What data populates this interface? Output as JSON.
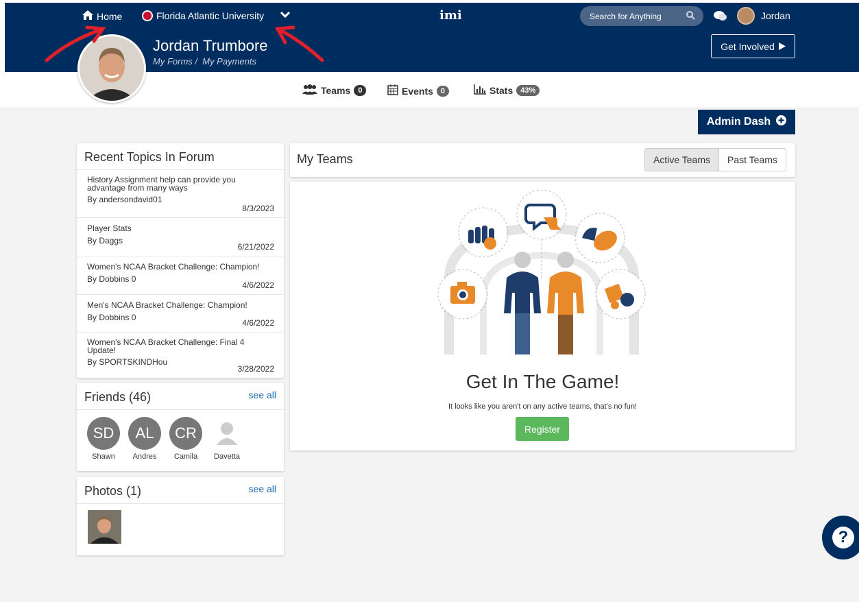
{
  "topnav": {
    "home_label": "Home",
    "school_label": "Florida Atlantic University",
    "logo_text": "imi",
    "search_placeholder": "Search for Anything",
    "user_name": "Jordan"
  },
  "profile": {
    "name": "Jordan Trumbore",
    "my_forms": "My Forms /",
    "my_payments": "My Payments",
    "get_involved": "Get Involved"
  },
  "tabs": [
    {
      "label": "Teams",
      "count": "0"
    },
    {
      "label": "Events",
      "count": "0"
    },
    {
      "label": "Stats",
      "count": "43%"
    }
  ],
  "admin_dash": "Admin Dash",
  "forum": {
    "title": "Recent Topics In Forum",
    "items": [
      {
        "title": "History Assignment help can provide you advantage from many ways",
        "author": "By andersondavid01",
        "date": "8/3/2023"
      },
      {
        "title": "Player Stats",
        "author": "By Daggs",
        "date": "6/21/2022"
      },
      {
        "title": "Women's NCAA Bracket Challenge: Champion!",
        "author": "By Dobbins 0",
        "date": "4/6/2022"
      },
      {
        "title": "Men's NCAA Bracket Challenge: Champion!",
        "author": "By Dobbins 0",
        "date": "4/6/2022"
      },
      {
        "title": "Women's NCAA Bracket Challenge: Final 4 Update!",
        "author": "By SPORTSKINDHou",
        "date": "3/28/2022"
      }
    ]
  },
  "friends": {
    "title": "Friends (46)",
    "see_all": "see all",
    "people": [
      {
        "initials": "SD",
        "name": "Shawn"
      },
      {
        "initials": "AL",
        "name": "Andres"
      },
      {
        "initials": "CR",
        "name": "Camila"
      },
      {
        "initials": "",
        "name": "Davetta"
      }
    ]
  },
  "photos": {
    "title": "Photos (1)",
    "see_all": "see all"
  },
  "my_teams": {
    "title": "My Teams",
    "active": "Active Teams",
    "past": "Past Teams",
    "heading": "Get In The Game!",
    "message": "It looks like you aren't on any active teams, that's no fun!",
    "register": "Register"
  },
  "colors": {
    "navy": "#002d5f",
    "orange": "#e8892a",
    "green": "#5cb85c",
    "annotation_red": "#e0202a"
  }
}
